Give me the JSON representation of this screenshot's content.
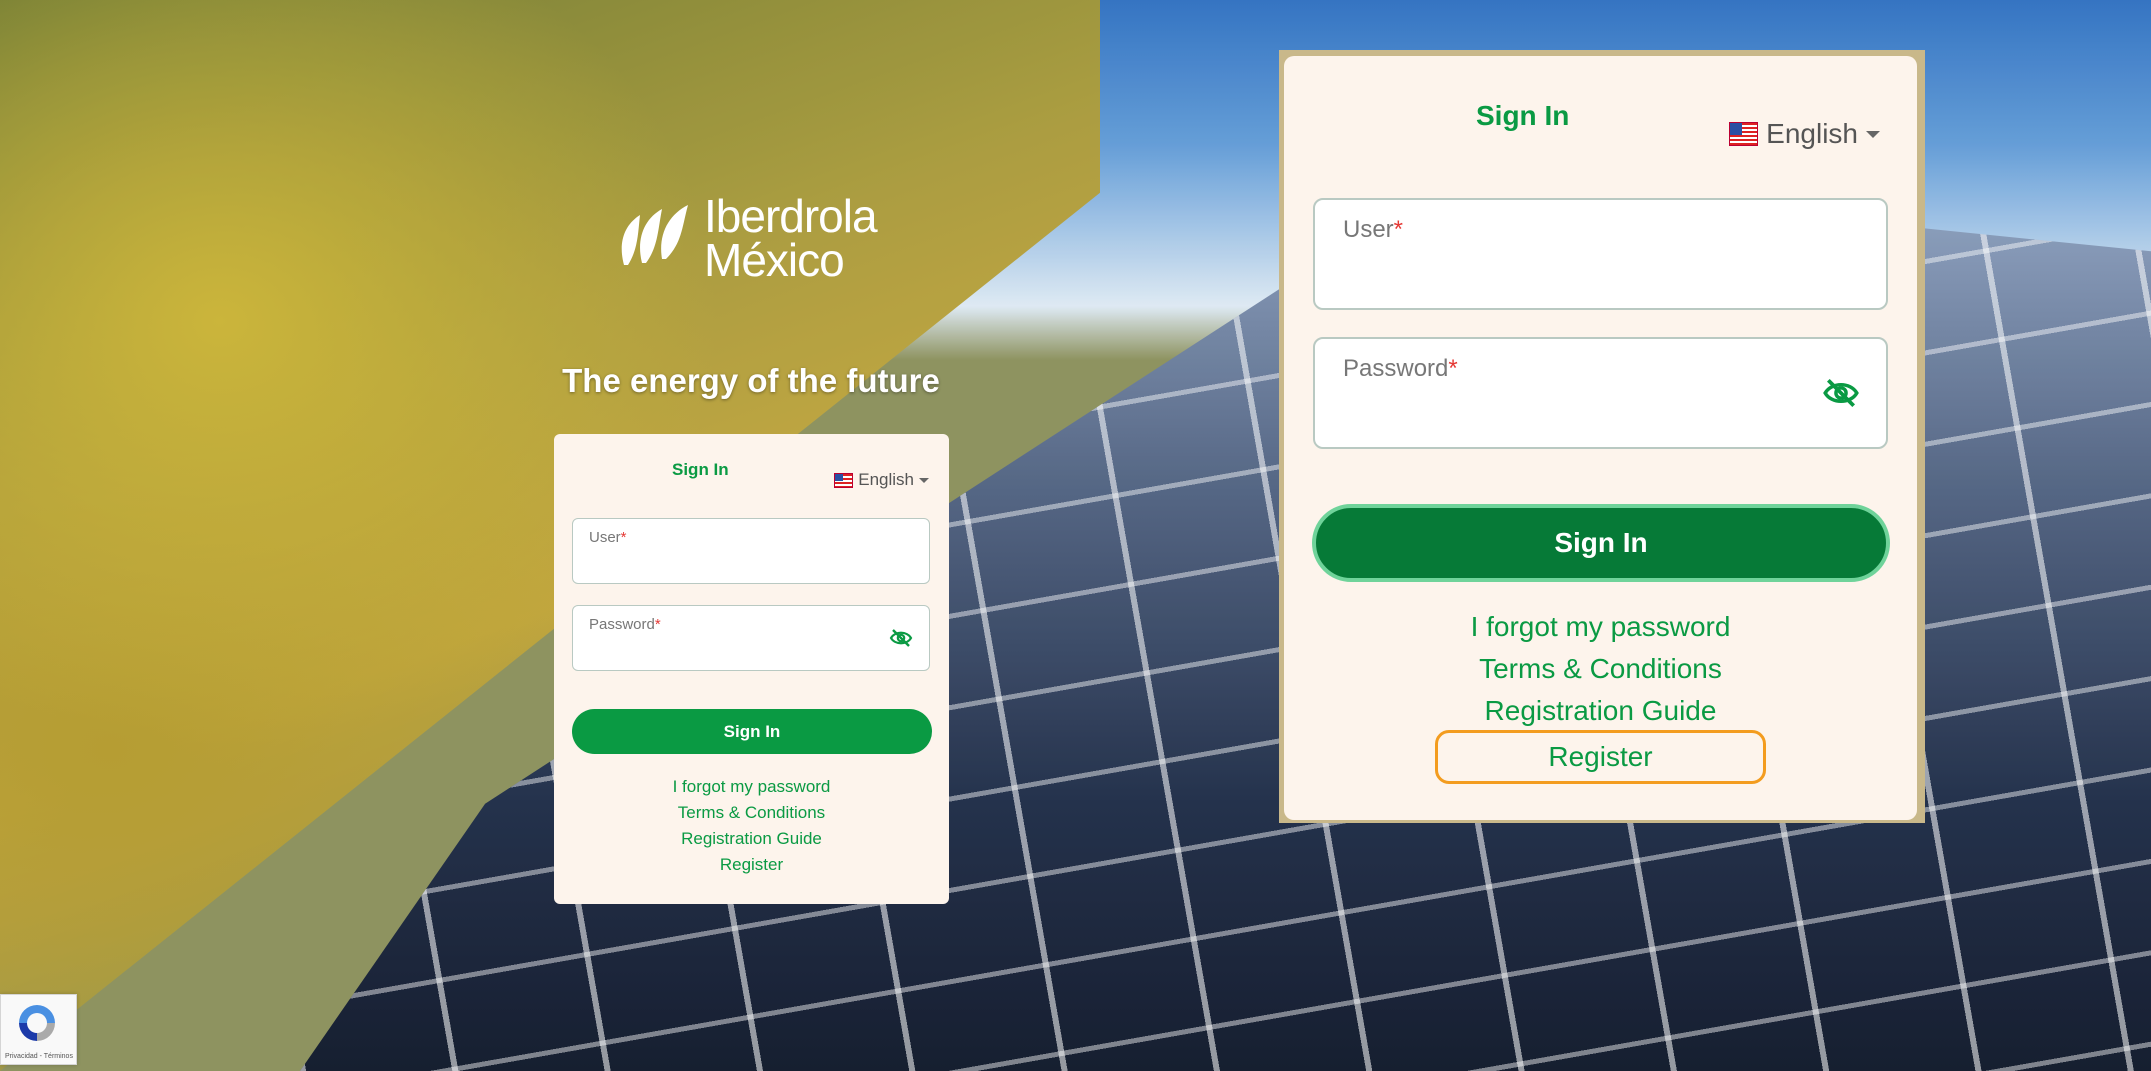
{
  "brand": {
    "line1": "Iberdrola",
    "line2": "México",
    "tagline": "The energy of the future"
  },
  "login": {
    "title": "Sign In",
    "language": "English",
    "user_label": "User",
    "password_label": "Password",
    "required_mark": "*",
    "submit": "Sign In",
    "links": {
      "forgot": "I forgot my password",
      "terms": "Terms & Conditions",
      "guide": "Registration Guide",
      "register": "Register"
    }
  },
  "recaptcha": {
    "footer": "Privacidad - Términos"
  },
  "colors": {
    "brand_green": "#0a9a43",
    "highlight": "#f39c1f",
    "card_bg": "#fdf4ec"
  },
  "icons": {
    "password_toggle": "eye-slash-icon",
    "flag": "us-flag-icon",
    "brand_logo": "iberdrola-leaves-icon"
  }
}
